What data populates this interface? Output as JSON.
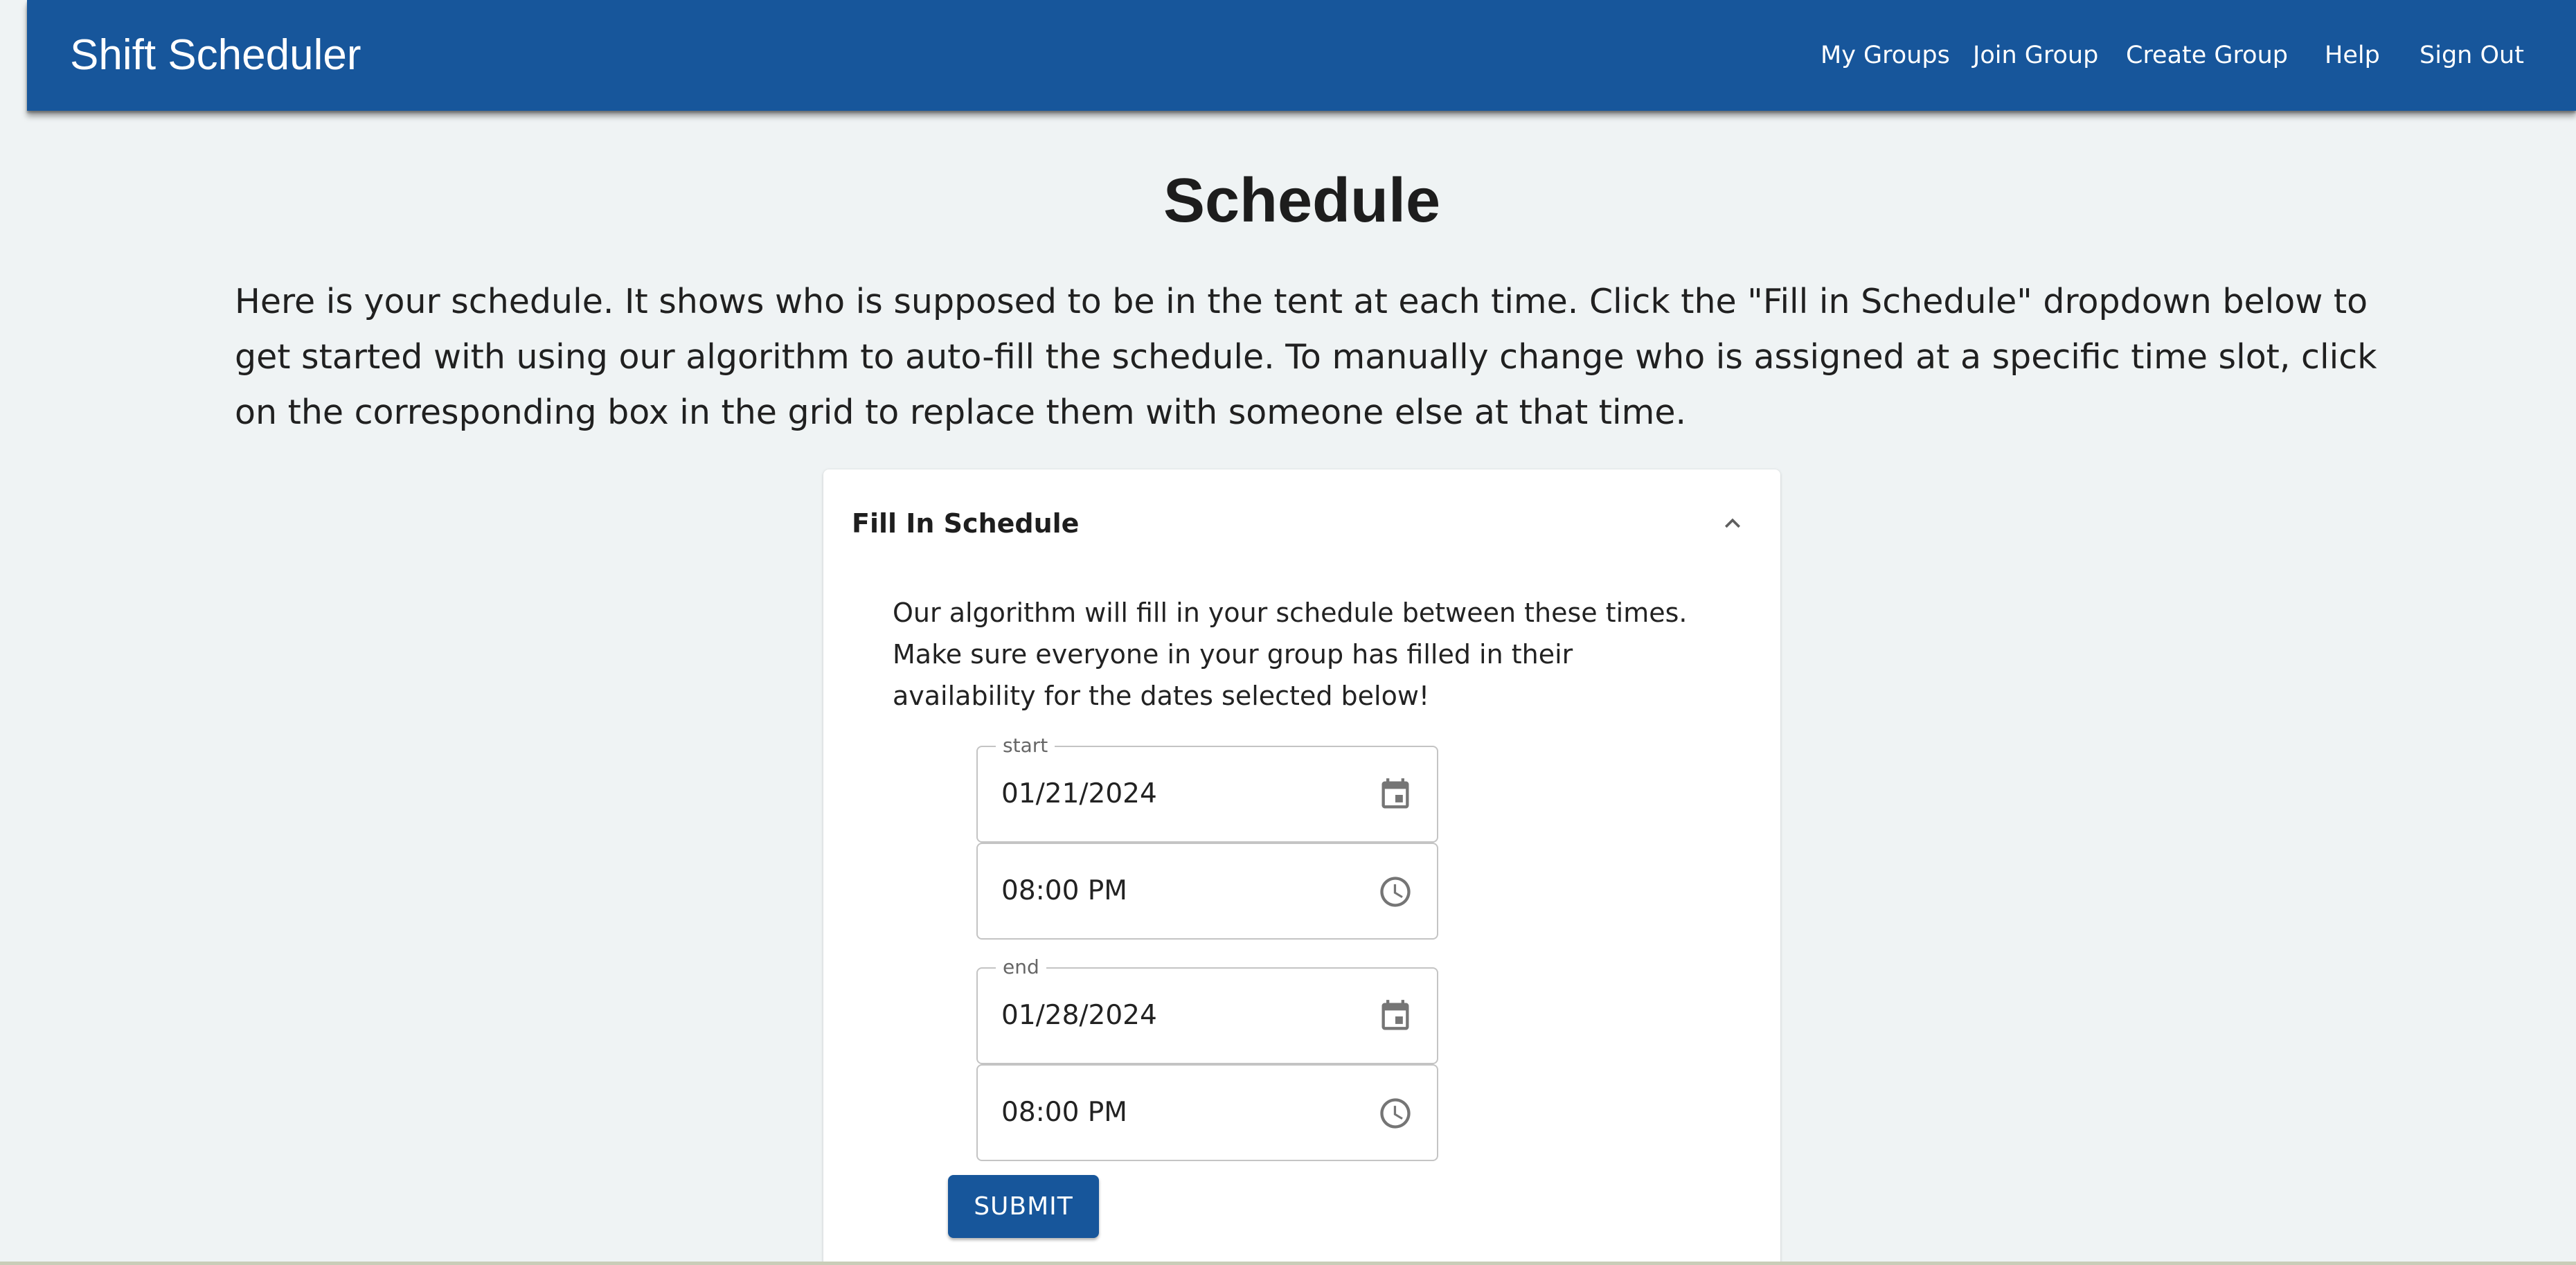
{
  "appbar": {
    "brand": "Shift Scheduler",
    "nav": [
      "My Groups",
      "Join Group",
      "Create Group",
      "Help",
      "Sign Out"
    ]
  },
  "page": {
    "title": "Schedule",
    "intro": "Here is your schedule. It shows who is supposed to be in the tent at each time. Click the \"Fill in Schedule\" dropdown below to get started with using our algorithm to auto-fill the schedule. To manually change who is assigned at a specific time slot, click on the corresponding box in the grid to replace them with someone else at that time."
  },
  "fill_in": {
    "title": "Fill In Schedule",
    "expanded": true,
    "description": "Our algorithm will fill in your schedule between these times. Make sure everyone in your group has filled in their availability for the dates selected below!",
    "start": {
      "label": "start",
      "date": "01/21/2024",
      "time": "08:00 PM"
    },
    "end": {
      "label": "end",
      "date": "01/28/2024",
      "time": "08:00 PM"
    },
    "submit_label": "SUBMIT"
  },
  "icons": {
    "expand": "chevron-up-icon",
    "date": "calendar-icon",
    "time": "clock-icon"
  },
  "colors": {
    "primary": "#17569b",
    "background": "#eff3f4",
    "card": "#ffffff",
    "icon": "#757575"
  }
}
